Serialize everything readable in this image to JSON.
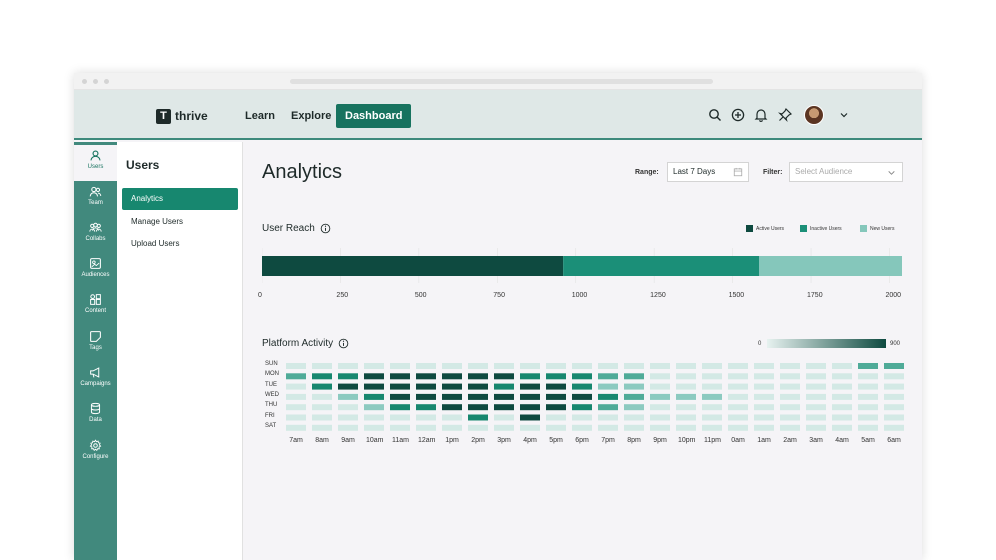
{
  "brand": {
    "logo_letter": "T",
    "name": "thrive"
  },
  "topnav": {
    "items": [
      {
        "label": "Learn"
      },
      {
        "label": "Explore"
      },
      {
        "label": "Dashboard"
      }
    ]
  },
  "sidebar": {
    "items": [
      {
        "label": "Users",
        "icon": "user-icon"
      },
      {
        "label": "Team",
        "icon": "team-icon"
      },
      {
        "label": "Collabs",
        "icon": "collabs-icon"
      },
      {
        "label": "Audiences",
        "icon": "audiences-icon"
      },
      {
        "label": "Content",
        "icon": "content-icon"
      },
      {
        "label": "Tags",
        "icon": "tag-icon"
      },
      {
        "label": "Campaigns",
        "icon": "megaphone-icon"
      },
      {
        "label": "Data",
        "icon": "database-icon"
      },
      {
        "label": "Configure",
        "icon": "gear-icon"
      }
    ]
  },
  "subnav": {
    "title": "Users",
    "items": [
      {
        "label": "Analytics"
      },
      {
        "label": "Manage Users"
      },
      {
        "label": "Upload Users"
      }
    ]
  },
  "main": {
    "title": "Analytics",
    "range_label": "Range:",
    "range_value": "Last 7 Days",
    "filter_label": "Filter:",
    "filter_placeholder": "Select Audience"
  },
  "colors": {
    "primary": "#17735f",
    "dark": "#0e4a40",
    "mid": "#1b8f78",
    "light": "#85c7bb",
    "topbar": "#dfe8e7",
    "sidebar": "#41897d"
  },
  "chart_data": [
    {
      "type": "bar",
      "title": "User Reach",
      "orientation": "horizontal-stacked",
      "series": [
        {
          "name": "Active Users",
          "value": 960,
          "color": "#0e4a40"
        },
        {
          "name": "Inactive Users",
          "value": 625,
          "color": "#1b8f78"
        },
        {
          "name": "New Users",
          "value": 455,
          "color": "#85c7bb"
        }
      ],
      "xticks": [
        "0",
        "250",
        "500",
        "750",
        "1000",
        "1250",
        "1500",
        "1750",
        "2000"
      ],
      "xlim": [
        0,
        2040
      ]
    },
    {
      "type": "heatmap",
      "title": "Platform Activity",
      "scale_min_label": "0",
      "scale_max_label": "900",
      "scale_max": 900,
      "rows": [
        "SUN",
        "MON",
        "TUE",
        "WED",
        "THU",
        "FRI",
        "SAT"
      ],
      "columns": [
        "7am",
        "8am",
        "9am",
        "10am",
        "11am",
        "12am",
        "1pm",
        "2pm",
        "3pm",
        "4pm",
        "5pm",
        "6pm",
        "7pm",
        "8pm",
        "9pm",
        "10pm",
        "11pm",
        "0am",
        "1am",
        "2am",
        "3am",
        "4am",
        "5am",
        "6am"
      ],
      "values": [
        [
          200,
          200,
          200,
          200,
          200,
          200,
          200,
          200,
          200,
          200,
          200,
          200,
          200,
          200,
          200,
          200,
          200,
          200,
          200,
          200,
          200,
          200,
          450,
          450
        ],
        [
          450,
          600,
          650,
          850,
          850,
          850,
          850,
          850,
          850,
          600,
          600,
          600,
          450,
          450,
          200,
          200,
          200,
          200,
          200,
          200,
          200,
          200,
          200,
          200
        ],
        [
          200,
          600,
          850,
          850,
          850,
          850,
          850,
          850,
          600,
          850,
          850,
          600,
          350,
          350,
          200,
          200,
          200,
          200,
          200,
          200,
          200,
          200,
          200,
          200
        ],
        [
          200,
          200,
          350,
          600,
          850,
          850,
          850,
          850,
          850,
          850,
          850,
          850,
          600,
          450,
          350,
          350,
          350,
          200,
          200,
          200,
          200,
          200,
          200,
          200
        ],
        [
          200,
          200,
          200,
          350,
          600,
          600,
          850,
          850,
          850,
          850,
          850,
          600,
          450,
          350,
          200,
          200,
          200,
          200,
          200,
          200,
          200,
          200,
          200,
          200
        ],
        [
          200,
          200,
          200,
          200,
          200,
          200,
          200,
          600,
          200,
          850,
          200,
          200,
          200,
          200,
          200,
          200,
          200,
          200,
          200,
          200,
          200,
          200,
          200,
          200
        ],
        [
          200,
          200,
          200,
          200,
          200,
          200,
          200,
          200,
          200,
          200,
          200,
          200,
          200,
          200,
          200,
          200,
          200,
          200,
          200,
          200,
          200,
          200,
          200,
          200
        ]
      ]
    }
  ]
}
